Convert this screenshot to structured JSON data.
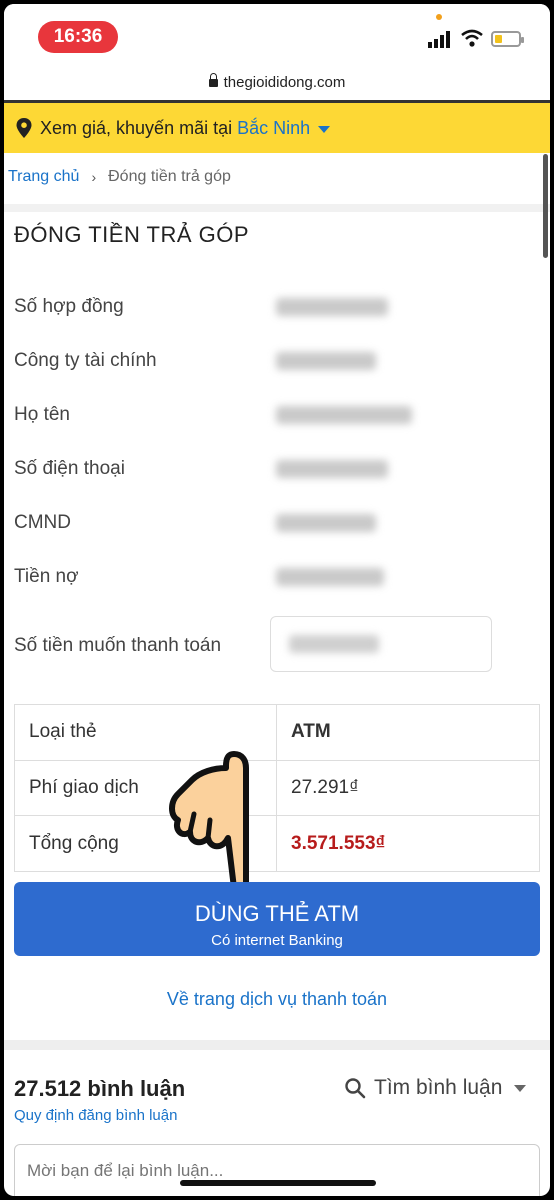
{
  "status_bar": {
    "time": "16:36",
    "battery_level": 0.3
  },
  "browser": {
    "url": "thegioididong.com"
  },
  "location_banner": {
    "prefix": "Xem giá, khuyến mãi tại",
    "city": "Bắc Ninh"
  },
  "breadcrumb": {
    "home": "Trang chủ",
    "separator": "›",
    "current": "Đóng tiền trả góp"
  },
  "page_title": "ĐÓNG TIỀN TRẢ GÓP",
  "info": {
    "contract_label": "Số hợp đồng",
    "finance_company_label": "Công ty tài chính",
    "name_label": "Họ tên",
    "phone_label": "Số điện thoại",
    "id_label": "CMND",
    "debt_label": "Tiền nợ",
    "pay_amount_label": "Số tiền muốn thanh toán"
  },
  "payment_table": {
    "card_type_label": "Loại thẻ",
    "card_type_value": "ATM",
    "fee_label": "Phí giao dịch",
    "fee_value": "27.291₫",
    "total_label": "Tổng cộng",
    "total_value": "3.571.553₫"
  },
  "atm_button": {
    "main": "DÙNG THẺ ATM",
    "sub": "Có internet Banking"
  },
  "back_link": "Về trang dịch vụ thanh toán",
  "comments": {
    "count": "27.512 bình luận",
    "policy": "Quy định đăng bình luận",
    "search": "Tìm bình luận",
    "placeholder": "Mời bạn để lại bình luận..."
  },
  "colors": {
    "accent": "#2e6bcf",
    "banner": "#fdd835",
    "link": "#1a73c9",
    "total": "#b71c1c"
  }
}
